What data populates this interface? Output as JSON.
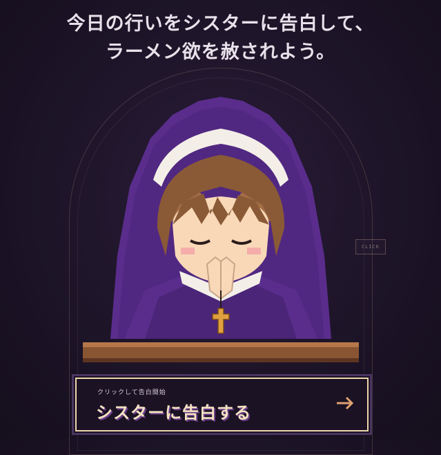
{
  "headline": {
    "line1": "今日の行いをシスターに告白して、",
    "line2": "ラーメン欲を赦されよう。"
  },
  "badge": {
    "label": "CLICK"
  },
  "cta": {
    "sub_label": "クリックして告白開始",
    "main_label": "シスターに告白する",
    "arrow_icon": "arrow-right-icon"
  },
  "colors": {
    "background": "#1d1428",
    "habit_purple": "#5a2d8c",
    "cta_border": "#f0d8ae",
    "cta_text": "#f4e3c2",
    "arrow": "#e0a070"
  }
}
